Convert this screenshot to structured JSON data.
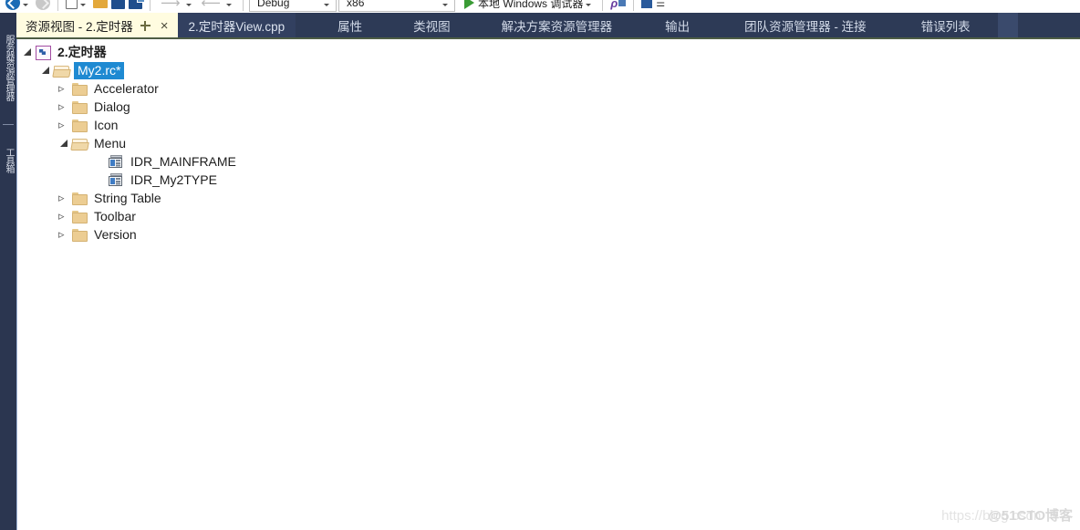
{
  "toolbar": {
    "nav_back": "navigate-back",
    "nav_forward": "navigate-forward",
    "new_item": "new-item",
    "open_file": "open-file",
    "save": "save",
    "save_all": "save-all",
    "undo": "undo",
    "redo": "redo",
    "config_combo": "Debug",
    "platform_combo": "x86",
    "run_label": "本地 Windows 调试器",
    "find_icon": "find-icon",
    "tool_icon": "tool-icon",
    "overflow": "toolbar-overflow"
  },
  "vertical_tabs": [
    {
      "label": "服务器资源管理器"
    },
    {
      "label": "工具箱"
    }
  ],
  "tabbar": {
    "active_tab": {
      "title": "资源视图 - 2.定时器",
      "pin": "pin-icon",
      "close": "×"
    },
    "document_tab": "2.定时器View.cpp",
    "tabs": [
      {
        "label": "属性"
      },
      {
        "label": "类视图"
      },
      {
        "label": "解决方案资源管理器"
      },
      {
        "label": "输出"
      },
      {
        "label": "团队资源管理器 - 连接"
      },
      {
        "label": "错误列表"
      }
    ]
  },
  "tree": [
    {
      "indent": 0,
      "expander": "expanded",
      "icon": "resource-script-icon",
      "label": "2.定时器",
      "bold": true,
      "selected": false
    },
    {
      "indent": 1,
      "expander": "expanded",
      "icon": "folder-open-icon",
      "label": "My2.rc*",
      "bold": false,
      "selected": true
    },
    {
      "indent": 2,
      "expander": "collapsed",
      "icon": "folder-icon",
      "label": "Accelerator",
      "bold": false,
      "selected": false
    },
    {
      "indent": 2,
      "expander": "collapsed",
      "icon": "folder-icon",
      "label": "Dialog",
      "bold": false,
      "selected": false
    },
    {
      "indent": 2,
      "expander": "collapsed",
      "icon": "folder-icon",
      "label": "Icon",
      "bold": false,
      "selected": false
    },
    {
      "indent": 2,
      "expander": "expanded",
      "icon": "folder-open-icon",
      "label": "Menu",
      "bold": false,
      "selected": false
    },
    {
      "indent": 3,
      "expander": "none",
      "icon": "menu-resource-icon",
      "label": "IDR_MAINFRAME",
      "bold": false,
      "selected": false
    },
    {
      "indent": 3,
      "expander": "none",
      "icon": "menu-resource-icon",
      "label": "IDR_My2TYPE",
      "bold": false,
      "selected": false
    },
    {
      "indent": 2,
      "expander": "collapsed",
      "icon": "folder-icon",
      "label": "String Table",
      "bold": false,
      "selected": false
    },
    {
      "indent": 2,
      "expander": "collapsed",
      "icon": "folder-icon",
      "label": "Toolbar",
      "bold": false,
      "selected": false
    },
    {
      "indent": 2,
      "expander": "collapsed",
      "icon": "folder-icon",
      "label": "Version",
      "bold": false,
      "selected": false
    }
  ],
  "watermark": {
    "url": "https://blog.csdn",
    "brand": "@51CTO博客"
  },
  "colors": {
    "chrome_navy": "#2b3650",
    "tab_active_bg": "#fffce0",
    "selection_blue": "#1f8ad2",
    "panel_bg": "#ffffff",
    "folder_gold": "#eccd93"
  }
}
